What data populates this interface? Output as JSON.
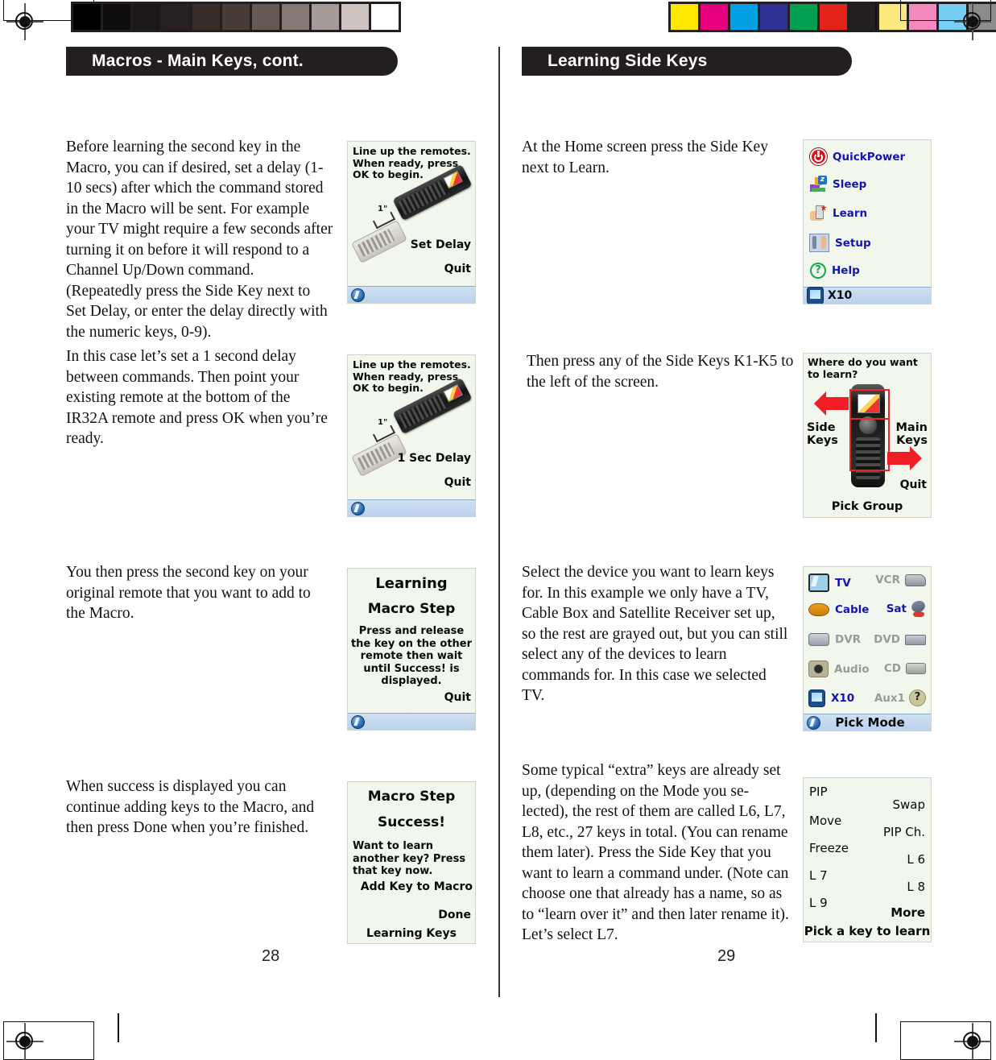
{
  "document": {
    "left_page_number": "28",
    "right_page_number": "29"
  },
  "left_page": {
    "heading": "Macros - Main Keys, cont.",
    "paragraphs": [
      "Before learning the second key in the Macro, you can if desired, set a delay (1-10 secs) after which the command stored in the Macro will be sent. For example your TV might require a few seconds after turning it on before it will respond to a Channel Up/Down command. (Repeatedly press the Side Key next to Set Delay, or enter the delay directly with the numeric keys, 0-9).",
      "In this case let’s set a 1 second delay between commands. Then point your existing remote at the bottom of the IR32A remote and press OK when you’re ready.",
      "You then press the second key on your original remote that you want to add to the Macro.",
      "When success is displayed you can continue adding keys to the Macro, and then press Done when you’re finished."
    ],
    "screens": [
      {
        "name": "line-up-set-delay",
        "prompt_lines": [
          "Line up the remotes.",
          "When ready, press",
          "OK to begin."
        ],
        "distance_label": "1\"",
        "action_label": "Set Delay",
        "quit_label": "Quit"
      },
      {
        "name": "line-up-1-sec-delay",
        "prompt_lines": [
          "Line up the remotes.",
          "When ready, press",
          "OK to begin."
        ],
        "distance_label": "1\"",
        "action_label": "1 Sec Delay",
        "quit_label": "Quit"
      },
      {
        "name": "learning-macro-step",
        "title": "Learning",
        "subtitle": "Macro Step",
        "body_lines": [
          "Press and release",
          "the key on the other",
          "remote then wait",
          "until Success! is",
          "displayed."
        ],
        "quit_label": "Quit"
      },
      {
        "name": "macro-step-success",
        "title": "Macro Step",
        "subtitle": "Success!",
        "body_lines": [
          "Want to learn",
          "another key? Press",
          "that key now."
        ],
        "add_label": "Add Key to Macro",
        "done_label": "Done",
        "footer": "Learning Keys"
      }
    ]
  },
  "right_page": {
    "heading": "Learning Side Keys",
    "paragraphs": [
      "At the Home screen press the Side Key next to Learn.",
      "Then press any of the Side Keys K1-K5 to the left of the screen.",
      "Select the device you want to learn keys for. In this example we only have a TV, Cable Box and Satellite Receiver set up, so the rest are grayed out, but you can still select any of the devices to learn commands for. In this case we selected TV.",
      "Some typical “extra” keys are already set up, (depending on the Mode you se-lected), the rest of them are called L6, L7, L8, etc., 27 keys in total. (You can rename them later). Press the Side Key that you want to learn a command under. (Note can choose one that already has a name, so as to “learn over it” and then later rename it). Let’s select L7."
    ],
    "home_menu": {
      "items": [
        {
          "label": "QuickPower",
          "icon": "power-icon"
        },
        {
          "label": "Sleep",
          "icon": "sleep-icon"
        },
        {
          "label": "Learn",
          "icon": "learn-icon"
        },
        {
          "label": "Setup",
          "icon": "setup-icon"
        },
        {
          "label": "Help",
          "icon": "help-icon"
        }
      ],
      "status_label": "X10"
    },
    "learn_where": {
      "prompt_lines": [
        "Where do you want",
        "to learn?"
      ],
      "left_label_lines": [
        "Side",
        "Keys"
      ],
      "right_label_lines": [
        "Main",
        "Keys"
      ],
      "quit_label": "Quit",
      "footer": "Pick Group"
    },
    "pick_mode": {
      "rows": [
        {
          "left": "TV",
          "left_state": "active",
          "right": "VCR",
          "right_state": "grayed"
        },
        {
          "left": "Cable",
          "left_state": "active",
          "right": "Sat",
          "right_state": "active"
        },
        {
          "left": "DVR",
          "left_state": "grayed",
          "right": "DVD",
          "right_state": "grayed"
        },
        {
          "left": "Audio",
          "left_state": "grayed",
          "right": "CD",
          "right_state": "grayed"
        },
        {
          "left": "X10",
          "left_state": "active",
          "right": "Aux1",
          "right_state": "grayed"
        }
      ],
      "footer": "Pick Mode"
    },
    "pick_key": {
      "left_keys": [
        "PIP",
        "Move",
        "Freeze",
        "L 7",
        "L 9"
      ],
      "right_keys": [
        "Swap",
        "PIP Ch.",
        "L 6",
        "L 8",
        "More"
      ],
      "more_label": "More",
      "footer": "Pick a key to learn"
    }
  },
  "calibration": {
    "gray_patches": [
      "#000000",
      "#100d0d",
      "#1d1818",
      "#272020",
      "#362c2a",
      "#483c39",
      "#655855",
      "#847775",
      "#a49a97",
      "#cdc4c2",
      "#ffffff"
    ],
    "color_patches": [
      "#ffe800",
      "#e6007e",
      "#00a0e3",
      "#2e3192",
      "#00a050",
      "#e2231a",
      "#231f20",
      "#fbe97f",
      "#f389bd",
      "#76cff2",
      "#8c8c8c"
    ]
  }
}
